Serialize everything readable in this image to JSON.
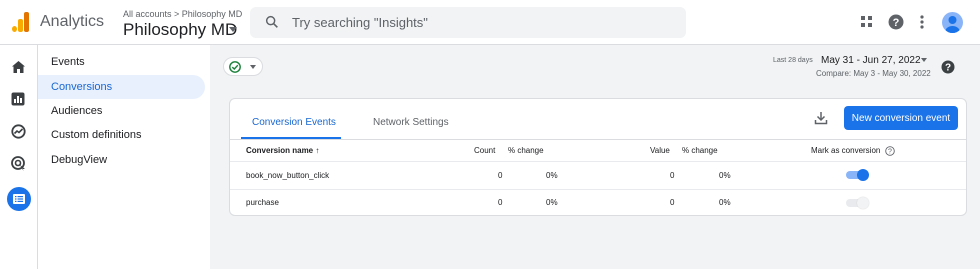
{
  "app": {
    "name": "Analytics",
    "breadcrumb": "All accounts > Philosophy MD",
    "property": "Philosophy MD"
  },
  "search": {
    "placeholder": "Try searching \"Insights\""
  },
  "topbar": {
    "icons": [
      "apps-icon",
      "help-icon",
      "more-vert-icon",
      "account-avatar"
    ]
  },
  "rail": {
    "icons": [
      "home-icon",
      "reports-icon",
      "explore-icon",
      "advertising-icon",
      "configure-icon"
    ],
    "active": "configure-icon"
  },
  "nav": {
    "items": [
      {
        "label": "Events"
      },
      {
        "label": "Conversions",
        "active": true
      },
      {
        "label": "Audiences"
      },
      {
        "label": "Custom definitions"
      },
      {
        "label": "DebugView"
      }
    ]
  },
  "date": {
    "days": "Last 28 days",
    "range": "May 31 - Jun 27, 2022",
    "compare": "Compare: May 3 - May 30, 2022"
  },
  "card": {
    "tabs": [
      {
        "label": "Conversion Events",
        "active": true
      },
      {
        "label": "Network Settings"
      }
    ],
    "new_button": "New conversion event",
    "columns": {
      "name": "Conversion name ↑",
      "count": "Count",
      "count_change": "% change",
      "value": "Value",
      "value_change": "% change",
      "mark": "Mark as conversion"
    },
    "rows": [
      {
        "name": "book_now_button_click",
        "count": "0",
        "count_change": "0%",
        "value": "0",
        "value_change": "0%",
        "marked": true
      },
      {
        "name": "purchase",
        "count": "0",
        "count_change": "0%",
        "value": "0",
        "value_change": "0%",
        "marked": false
      }
    ]
  },
  "colors": {
    "accent": "#1a73e8",
    "logo": "#f9ab00",
    "active_nav_bg": "#e8f0fe"
  }
}
